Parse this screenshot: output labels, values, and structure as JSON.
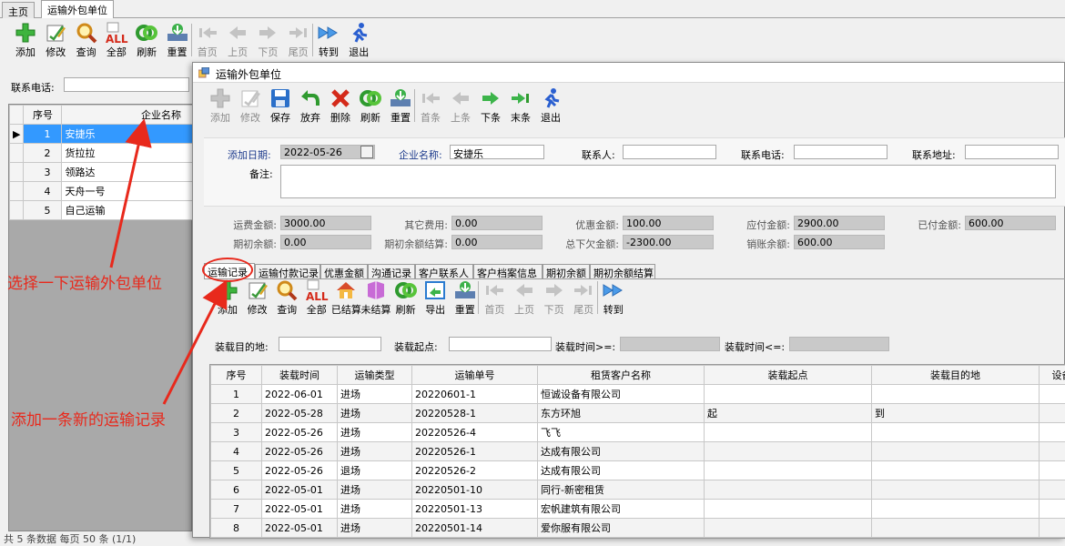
{
  "outer_tabs": [
    "主页",
    "运输外包单位"
  ],
  "outer_toolbar": [
    {
      "label": "添加",
      "icon": "plus-icon",
      "enabled": true
    },
    {
      "label": "修改",
      "icon": "edit-icon",
      "enabled": true
    },
    {
      "label": "查询",
      "icon": "search-icon",
      "enabled": true
    },
    {
      "label": "全部",
      "icon": "all-icon",
      "enabled": true
    },
    {
      "label": "刷新",
      "icon": "refresh-icon",
      "enabled": true
    },
    {
      "label": "重置",
      "icon": "reset-icon",
      "enabled": true
    },
    {
      "label": "首页",
      "icon": "first-icon",
      "enabled": false
    },
    {
      "label": "上页",
      "icon": "prev-icon",
      "enabled": false
    },
    {
      "label": "下页",
      "icon": "next-icon",
      "enabled": false
    },
    {
      "label": "尾页",
      "icon": "last-icon",
      "enabled": false
    },
    {
      "label": "转到",
      "icon": "goto-icon",
      "enabled": true
    },
    {
      "label": "退出",
      "icon": "exit-icon",
      "enabled": true
    }
  ],
  "left_filter": {
    "label": "联系电话:",
    "value": ""
  },
  "left_grid": {
    "headers": [
      "序号",
      "企业名称"
    ],
    "rows": [
      {
        "no": "1",
        "name": "安捷乐"
      },
      {
        "no": "2",
        "name": "货拉拉"
      },
      {
        "no": "3",
        "name": "领路达"
      },
      {
        "no": "4",
        "name": "天舟一号"
      },
      {
        "no": "5",
        "name": "自己运输"
      }
    ],
    "status": "共 5 条数据 每页 50 条 (1/1)"
  },
  "dialog": {
    "title": "运输外包单位",
    "toolbar": [
      {
        "label": "添加",
        "icon": "plus-icon",
        "enabled": false
      },
      {
        "label": "修改",
        "icon": "edit-icon",
        "enabled": false
      },
      {
        "label": "保存",
        "icon": "save-icon",
        "enabled": true
      },
      {
        "label": "放弃",
        "icon": "undo-icon",
        "enabled": true
      },
      {
        "label": "删除",
        "icon": "delete-icon",
        "enabled": true
      },
      {
        "label": "刷新",
        "icon": "refresh-icon",
        "enabled": true
      },
      {
        "label": "重置",
        "icon": "reset-icon",
        "enabled": true
      },
      {
        "label": "首条",
        "icon": "first-icon",
        "enabled": false
      },
      {
        "label": "上条",
        "icon": "prev-icon",
        "enabled": false
      },
      {
        "label": "下条",
        "icon": "next-icon",
        "enabled": true
      },
      {
        "label": "末条",
        "icon": "last-icon",
        "enabled": true
      },
      {
        "label": "退出",
        "icon": "exit-icon",
        "enabled": true
      }
    ],
    "form": {
      "add_date_label": "添加日期:",
      "add_date": "2022-05-26",
      "company_label": "企业名称:",
      "company": "安捷乐",
      "contact_label": "联系人:",
      "contact": "",
      "phone_label": "联系电话:",
      "phone": "",
      "address_label": "联系地址:",
      "address": "",
      "remark_label": "备注:",
      "remark": ""
    },
    "summary": [
      {
        "label": "运费金额:",
        "value": "3000.00"
      },
      {
        "label": "其它费用:",
        "value": "0.00"
      },
      {
        "label": "优惠金额:",
        "value": "100.00"
      },
      {
        "label": "应付金额:",
        "value": "2900.00"
      },
      {
        "label": "已付金额:",
        "value": "600.00"
      },
      {
        "label": "期初余额:",
        "value": "0.00"
      },
      {
        "label": "期初余额结算:",
        "value": "0.00"
      },
      {
        "label": "总下欠金额:",
        "value": "-2300.00"
      },
      {
        "label": "销账余额:",
        "value": "600.00"
      }
    ],
    "inner_tabs": [
      "运输记录",
      "运输付款记录",
      "优惠金额",
      "沟通记录",
      "客户联系人",
      "客户档案信息",
      "期初余额",
      "期初余额结算"
    ],
    "inner_toolbar": [
      {
        "label": "添加",
        "icon": "plus-icon",
        "enabled": true
      },
      {
        "label": "修改",
        "icon": "edit-icon",
        "enabled": true
      },
      {
        "label": "查询",
        "icon": "search-icon",
        "enabled": true
      },
      {
        "label": "全部",
        "icon": "all-icon",
        "enabled": true
      },
      {
        "label": "已结算",
        "icon": "house-icon",
        "enabled": true
      },
      {
        "label": "未结算",
        "icon": "book-icon",
        "enabled": true
      },
      {
        "label": "刷新",
        "icon": "refresh-icon",
        "enabled": true
      },
      {
        "label": "导出",
        "icon": "export-icon",
        "enabled": true
      },
      {
        "label": "重置",
        "icon": "reset-icon",
        "enabled": true
      },
      {
        "label": "首页",
        "icon": "first-icon",
        "enabled": false
      },
      {
        "label": "上页",
        "icon": "prev-icon",
        "enabled": false
      },
      {
        "label": "下页",
        "icon": "next-icon",
        "enabled": false
      },
      {
        "label": "尾页",
        "icon": "last-icon",
        "enabled": false
      },
      {
        "label": "转到",
        "icon": "goto-icon",
        "enabled": true
      }
    ],
    "filters": {
      "dest_label": "装载目的地:",
      "dest": "",
      "origin_label": "装载起点:",
      "origin": "",
      "time_from_label": "装载时间>=:",
      "time_from": "",
      "time_to_label": "装载时间<=:",
      "time_to": ""
    },
    "grid": {
      "headers": [
        "序号",
        "装载时间",
        "运输类型",
        "运输单号",
        "租赁客户名称",
        "装载起点",
        "装载目的地",
        "设备"
      ],
      "rows": [
        {
          "no": "1",
          "time": "2022-06-01",
          "type": "进场",
          "order": "20220601-1",
          "client": "恒诚设备有限公司",
          "origin": "",
          "dest": ""
        },
        {
          "no": "2",
          "time": "2022-05-28",
          "type": "进场",
          "order": "20220528-1",
          "client": "东方环旭",
          "origin": "起",
          "dest": "到"
        },
        {
          "no": "3",
          "time": "2022-05-26",
          "type": "进场",
          "order": "20220526-4",
          "client": "飞飞",
          "origin": "",
          "dest": ""
        },
        {
          "no": "4",
          "time": "2022-05-26",
          "type": "进场",
          "order": "20220526-1",
          "client": "达成有限公司",
          "origin": "",
          "dest": ""
        },
        {
          "no": "5",
          "time": "2022-05-26",
          "type": "退场",
          "order": "20220526-2",
          "client": "达成有限公司",
          "origin": "",
          "dest": ""
        },
        {
          "no": "6",
          "time": "2022-05-01",
          "type": "进场",
          "order": "20220501-10",
          "client": "同行-新密租赁",
          "origin": "",
          "dest": ""
        },
        {
          "no": "7",
          "time": "2022-05-01",
          "type": "进场",
          "order": "20220501-13",
          "client": "宏帆建筑有限公司",
          "origin": "",
          "dest": ""
        },
        {
          "no": "8",
          "time": "2022-05-01",
          "type": "进场",
          "order": "20220501-14",
          "client": "爱你服有限公司",
          "origin": "",
          "dest": ""
        }
      ]
    }
  },
  "annotations": {
    "select_unit": "选择一下运输外包单位",
    "add_record": "添加一条新的运输记录"
  },
  "colors": {
    "accent": "#e8291c",
    "selection": "#3399ff"
  }
}
